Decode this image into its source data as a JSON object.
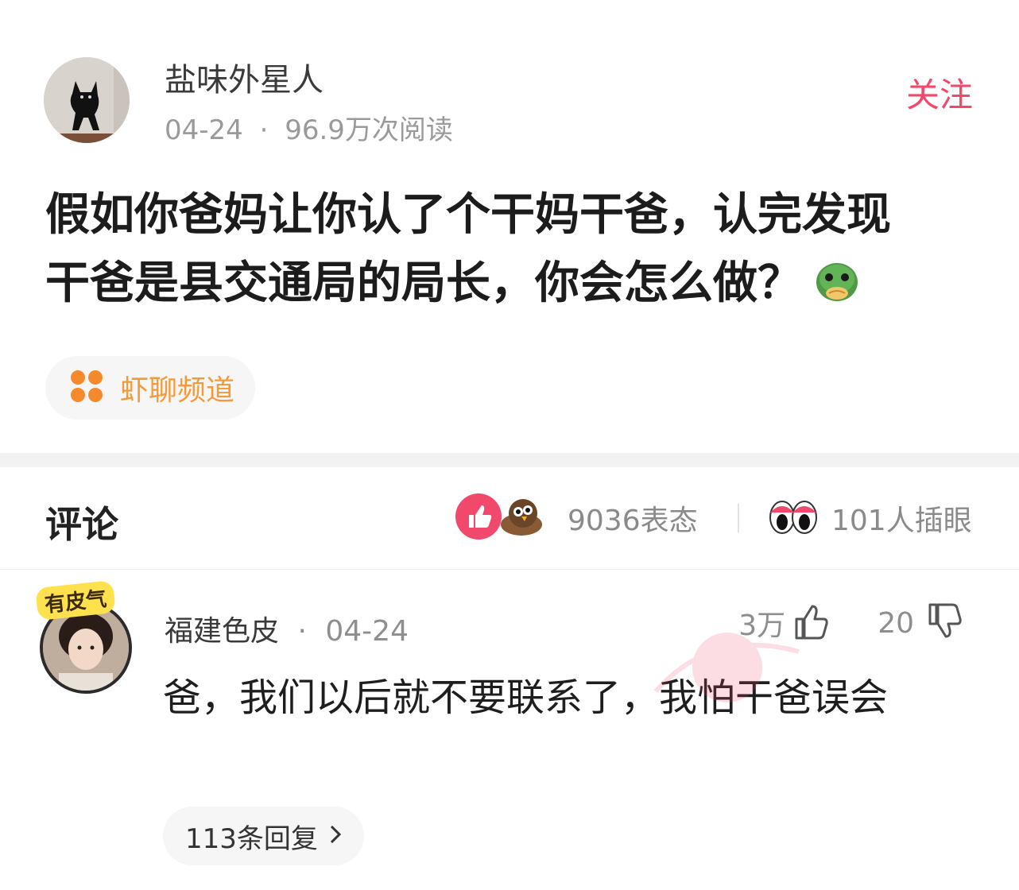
{
  "post": {
    "author_name": "盐味外星人",
    "date": "04-24",
    "separator": "·",
    "reads": "96.9万次阅读",
    "follow_label": "关注",
    "body_line1": "假如你爸妈让你认了个干妈干爸，认完发现",
    "body_line2": "干爸是县交通局的局长，你会怎么做？",
    "body_emoji": "frog-face-icon",
    "channel_label": "虾聊频道",
    "channel_icon": "four-dots-icon"
  },
  "comments": {
    "title": "评论",
    "reactions_count": "9036表态",
    "eyes_count": "101人插眼",
    "items": [
      {
        "badge": "有皮气",
        "user": "福建色皮",
        "separator": "·",
        "date": "04-24",
        "likes": "3万",
        "dislikes": "20",
        "text": "爸，我们以后就不要联系了，我怕干爸误会",
        "replies_label": "113条回复"
      }
    ]
  },
  "colors": {
    "accent_pink": "#f0496b",
    "channel_orange": "#f39a3a",
    "meta_gray": "#8e8e8e"
  }
}
